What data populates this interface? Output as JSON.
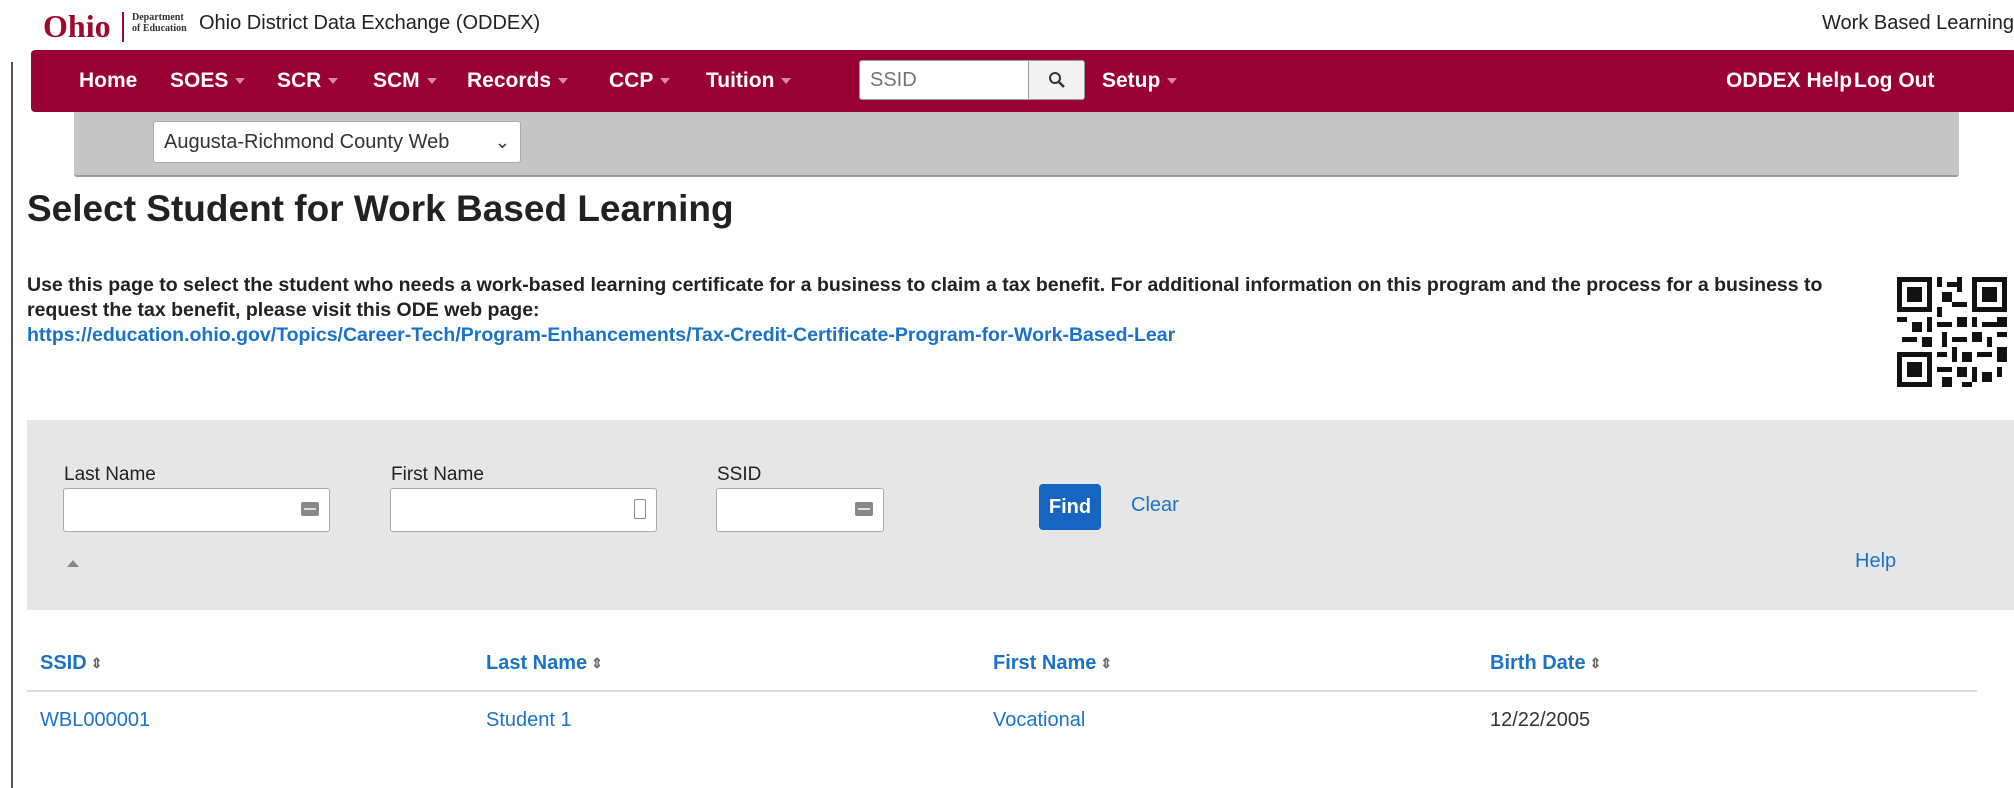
{
  "brand": {
    "logo_text": "Ohio",
    "dept_line1": "Department",
    "dept_line2": "of Education",
    "app_title": "Ohio District Data Exchange (ODDEX)",
    "module_name": "Work Based Learning"
  },
  "nav": {
    "home": "Home",
    "soes": "SOES",
    "scr": "SCR",
    "scm": "SCM",
    "records": "Records",
    "ccp": "CCP",
    "tuition": "Tuition",
    "ssid_placeholder": "SSID",
    "setup": "Setup",
    "help": "ODDEX Help",
    "logout": "Log Out"
  },
  "district_select": "Augusta-Richmond County Web",
  "page": {
    "title": "Select Student for Work Based Learning",
    "intro": "Use this page to select the student who needs a work-based learning certificate for a business to claim a tax benefit. For additional information on this program and the process for a business to request the tax benefit, please visit this ODE web page:",
    "intro_link": "https://education.ohio.gov/Topics/Career-Tech/Program-Enhancements/Tax-Credit-Certificate-Program-for-Work-Based-Lear"
  },
  "filter": {
    "last_name_label": "Last Name",
    "first_name_label": "First Name",
    "ssid_label": "SSID",
    "last_name_value": "",
    "first_name_value": "",
    "ssid_value": "",
    "find": "Find",
    "clear": "Clear",
    "help": "Help"
  },
  "table": {
    "headers": [
      "SSID",
      "Last Name",
      "First Name",
      "Birth Date"
    ],
    "rows": [
      [
        "WBL000001",
        "Student 1",
        "Vocational",
        "12/22/2005"
      ]
    ]
  },
  "icons": {
    "search": "search-icon",
    "sort": "sort-icon",
    "dropdown": "chevron-down-icon",
    "collapse": "collapse-icon",
    "qr": "qr-code-icon"
  },
  "colors": {
    "nav_bg": "#990033",
    "link": "#1a73c8",
    "button": "#1665c1"
  }
}
